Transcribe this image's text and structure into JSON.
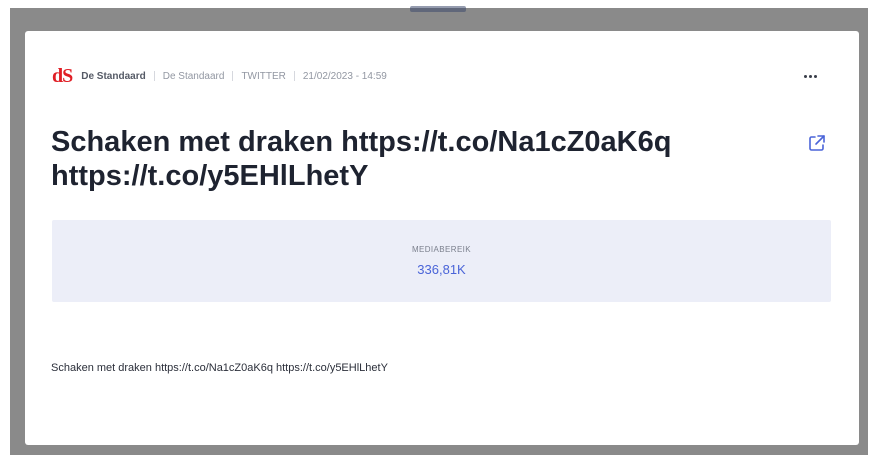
{
  "article": {
    "logo": "dS",
    "source_name": "De Standaard",
    "author": "De Standaard",
    "channel": "TWITTER",
    "datetime": "21/02/2023 - 14:59",
    "title_line1": "Schaken met draken https://t.co/Na1cZ0aK6q",
    "title_line2": "https://t.co/y5EHlLhetY",
    "reach_label": "MEDIABEREIK",
    "reach_value": "336,81K",
    "body": "Schaken met draken https://t.co/Na1cZ0aK6q https://t.co/y5EHlLhetY"
  },
  "colors": {
    "logo": "#e01f26",
    "accent": "#4a64d8",
    "reach_bg": "#eceef8"
  },
  "icons": {
    "more": "more-horizontal-icon",
    "external": "external-link-icon"
  }
}
